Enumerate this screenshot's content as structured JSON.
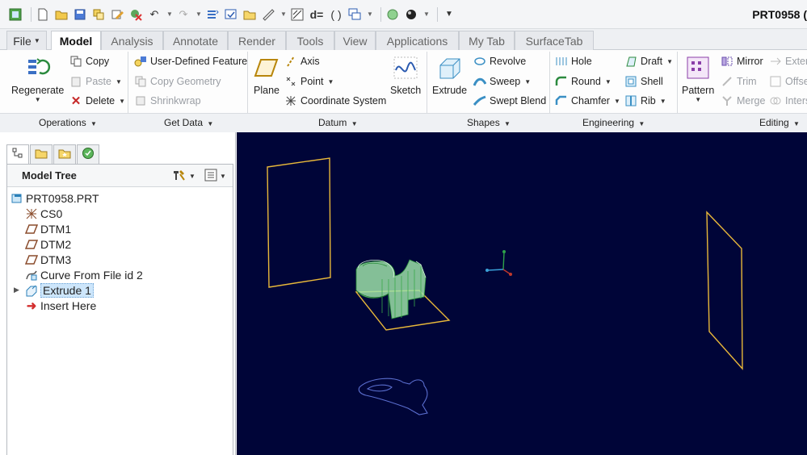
{
  "window": {
    "title": "PRT0958 ("
  },
  "quick_access": {
    "icons": [
      "app-icon",
      "new-icon",
      "open-icon",
      "save-icon",
      "regenerate-icon",
      "edit-icon",
      "cancel-icon",
      "undo-icon",
      "redo-icon",
      "regen-mgr-icon",
      "window-icon",
      "folder-icon",
      "measure-icon",
      "model-display-icon",
      "relations-icon",
      "parameters-icon",
      "windows-icon",
      "appearance-icon",
      "render-icon",
      "customize-icon"
    ]
  },
  "tabs": [
    {
      "label": "File"
    },
    {
      "label": "Model"
    },
    {
      "label": "Analysis"
    },
    {
      "label": "Annotate"
    },
    {
      "label": "Render"
    },
    {
      "label": "Tools"
    },
    {
      "label": "View"
    },
    {
      "label": "Applications"
    },
    {
      "label": "My Tab"
    },
    {
      "label": "SurfaceTab"
    }
  ],
  "ribbon": {
    "operations": {
      "regenerate": "Regenerate",
      "copy": "Copy",
      "paste": "Paste",
      "delete": "Delete",
      "label": "Operations"
    },
    "get_data": {
      "udf": "User-Defined Feature",
      "copy_geometry": "Copy Geometry",
      "shrinkwrap": "Shrinkwrap",
      "label": "Get Data"
    },
    "datum": {
      "plane": "Plane",
      "axis": "Axis",
      "point": "Point",
      "csys": "Coordinate System",
      "sketch": "Sketch",
      "label": "Datum"
    },
    "shapes": {
      "extrude": "Extrude",
      "revolve": "Revolve",
      "sweep": "Sweep",
      "swept_blend": "Swept Blend",
      "label": "Shapes"
    },
    "engineering": {
      "hole": "Hole",
      "round": "Round",
      "chamfer": "Chamfer",
      "draft": "Draft",
      "shell": "Shell",
      "rib": "Rib",
      "label": "Engineering"
    },
    "editing": {
      "pattern": "Pattern",
      "mirror": "Mirror",
      "trim": "Trim",
      "merge": "Merge",
      "extend": "Exter",
      "offset": "Offse",
      "intersect": "Inters",
      "label": "Editing"
    }
  },
  "model_tree": {
    "header": "Model Tree",
    "items": [
      {
        "label": "PRT0958.PRT",
        "icon": "part-icon"
      },
      {
        "label": "CS0",
        "icon": "csys-icon"
      },
      {
        "label": "DTM1",
        "icon": "datum-plane-icon"
      },
      {
        "label": "DTM2",
        "icon": "datum-plane-icon"
      },
      {
        "label": "DTM3",
        "icon": "datum-plane-icon"
      },
      {
        "label": "Curve From File id 2",
        "icon": "curve-icon"
      },
      {
        "label": "Extrude 1",
        "icon": "extrude-icon"
      },
      {
        "label": "Insert Here",
        "icon": "insert-arrow-icon"
      }
    ]
  },
  "colors": {
    "viewport_bg": "#000538",
    "datum_plane": "#e8b83a",
    "solid": "#9be0a8",
    "curve": "#5b6fd0"
  }
}
